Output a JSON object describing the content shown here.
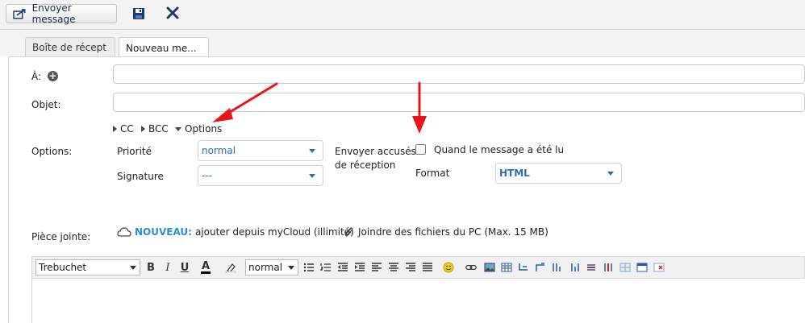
{
  "toolbar": {
    "send_label": "Envoyer message",
    "icons": [
      "send-icon",
      "save-icon",
      "close-icon"
    ]
  },
  "tabs": [
    {
      "label": "Boîte de récept",
      "active": false
    },
    {
      "label": "Nouveau me...",
      "active": true
    }
  ],
  "form": {
    "to_label": "À:",
    "subject_label": "Objet:",
    "to_value": "",
    "subject_value": "",
    "toggles": {
      "cc": "CC",
      "bcc": "BCC",
      "options": "Options"
    },
    "options_label": "Options:",
    "priority_label": "Priorité",
    "priority_value": "normal",
    "signature_label": "Signature",
    "signature_value": "---",
    "receipt_label_line1": "Envoyer accusés",
    "receipt_label_line2": "de réception",
    "receipt_checkbox_label": "Quand le message a été lu",
    "receipt_checked": false,
    "format_label": "Format",
    "format_value": "HTML",
    "attachment_label": "Pièce jointe:",
    "attach_new": "NOUVEAU:",
    "attach_cloud": "ajouter depuis myCloud (illimité)",
    "attach_pc": "Joindre des fichiers du PC (Max. 15 MB)"
  },
  "editor": {
    "font_value": "Trebuchet",
    "size_value": "normal",
    "bold": "B",
    "italic": "I",
    "underline": "U",
    "font_color_glyph": "A"
  },
  "colors": {
    "accent_blue": "#2a6fb5",
    "nouveau_blue": "#2a8fd0",
    "arrow_red": "#e8161a",
    "toolbar_bg": "#f3f3f3"
  }
}
